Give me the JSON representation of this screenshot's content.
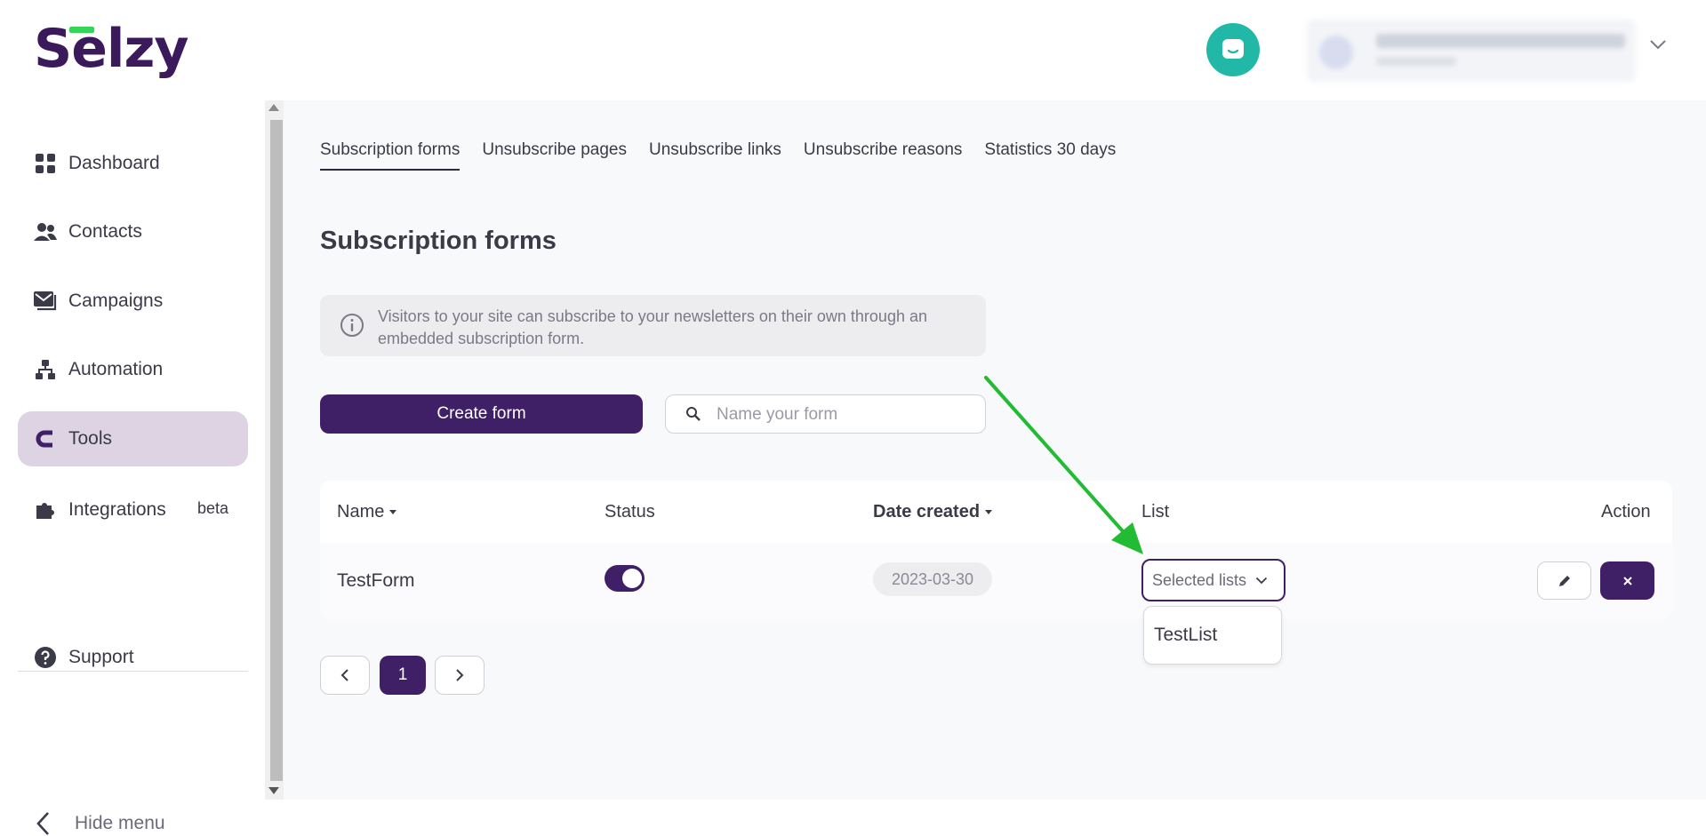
{
  "app": {
    "logo_text": "Selzy",
    "accent_color": "#3f1f66",
    "logo_bar_color": "#35d657",
    "chat_color": "#22b8a8"
  },
  "header": {
    "icons": [
      "chat-icon",
      "chevron-down-icon"
    ]
  },
  "sidebar": {
    "items": [
      {
        "label": "Dashboard",
        "icon": "dashboard-grid-icon"
      },
      {
        "label": "Contacts",
        "icon": "users-icon"
      },
      {
        "label": "Campaigns",
        "icon": "mail-icon"
      },
      {
        "label": "Automation",
        "icon": "flow-tree-icon"
      },
      {
        "label": "Tools",
        "icon": "magnet-icon",
        "active": true
      },
      {
        "label": "Integrations",
        "icon": "puzzle-icon",
        "badge": "beta"
      }
    ],
    "support_label": "Support",
    "hide_menu_label": "Hide menu"
  },
  "tabs": [
    {
      "label": "Subscription forms",
      "active": true
    },
    {
      "label": "Unsubscribe pages"
    },
    {
      "label": "Unsubscribe links"
    },
    {
      "label": "Unsubscribe reasons"
    },
    {
      "label": "Statistics 30 days"
    }
  ],
  "main": {
    "title": "Subscription forms",
    "info_text": "Visitors to your site can subscribe to your newsletters on their own through an embedded subscription form.",
    "create_button": "Create form",
    "search_placeholder": "Name your form"
  },
  "table": {
    "columns": [
      "Name",
      "Status",
      "Date created",
      "List",
      "Action"
    ],
    "rows": [
      {
        "name": "TestForm",
        "status_on": true,
        "date_created": "2023-03-30",
        "list_select_label": "Selected lists"
      }
    ],
    "dropdown_options": [
      "TestList"
    ]
  },
  "pagination": {
    "current_page": "1"
  },
  "annotation": {
    "arrow_color": "#22bb33"
  }
}
